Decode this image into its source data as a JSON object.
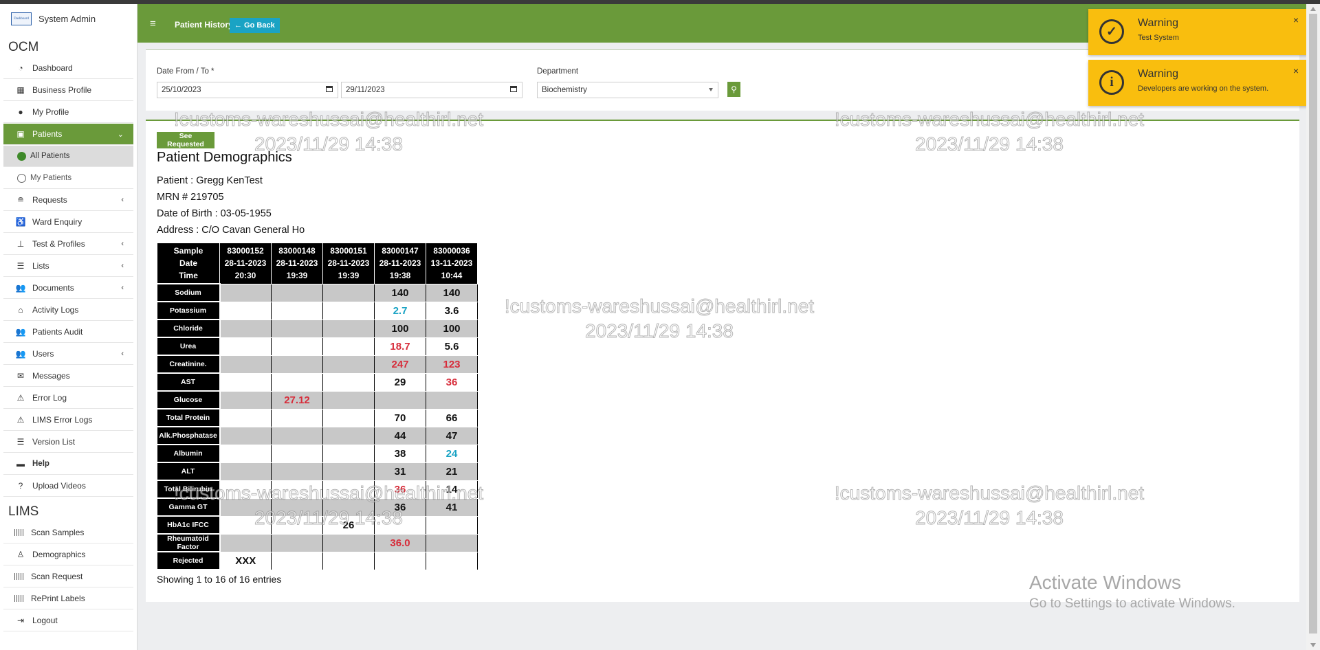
{
  "sidebar": {
    "user": "System Admin",
    "logo_text": "Dashboard",
    "sections": {
      "ocm": "OCM",
      "lims": "LIMS"
    },
    "items": [
      {
        "label": "Dashboard",
        "icon": "tachometer-icon"
      },
      {
        "label": "Business Profile",
        "icon": "building-icon"
      },
      {
        "label": "My Profile",
        "icon": "user-icon"
      },
      {
        "label": "Patients",
        "icon": "id-card-icon"
      },
      {
        "label": "All Patients"
      },
      {
        "label": "My Patients"
      },
      {
        "label": "Requests",
        "icon": "database-icon"
      },
      {
        "label": "Ward Enquiry",
        "icon": "wheelchair-icon"
      },
      {
        "label": "Test & Profiles",
        "icon": "flask-icon"
      },
      {
        "label": "Lists",
        "icon": "list-icon"
      },
      {
        "label": "Documents",
        "icon": "users-icon"
      },
      {
        "label": "Activity Logs",
        "icon": "bank-icon"
      },
      {
        "label": "Patients Audit",
        "icon": "users-icon"
      },
      {
        "label": "Users",
        "icon": "users-icon"
      },
      {
        "label": "Messages",
        "icon": "envelope-icon"
      },
      {
        "label": "Error Log",
        "icon": "warning-icon"
      },
      {
        "label": "LIMS Error Logs",
        "icon": "warning-icon"
      },
      {
        "label": "Version List",
        "icon": "list-icon"
      },
      {
        "label": "Help",
        "icon": "keyboard-icon"
      },
      {
        "label": "Upload Videos",
        "icon": "question-icon"
      }
    ],
    "lims_items": [
      {
        "label": "Scan Samples",
        "icon": "barcode-icon"
      },
      {
        "label": "Demographics",
        "icon": "user-tie-icon"
      },
      {
        "label": "Scan Request",
        "icon": "barcode-icon"
      },
      {
        "label": "RePrint Labels",
        "icon": "barcode-icon"
      },
      {
        "label": "Logout",
        "icon": "sign-out-icon"
      }
    ]
  },
  "header": {
    "menu_glyph": "≡",
    "title": "Patient History",
    "go_back": "← Go Back"
  },
  "filter": {
    "date_label": "Date From / To *",
    "date_from": "25/10/2023",
    "date_to": "29/11/2023",
    "department_label": "Department",
    "department_value": "Biochemistry",
    "search_glyph": "⚲"
  },
  "main": {
    "see_requested": "See Requested",
    "heading": "Patient Demographics",
    "patient": "Patient : Gregg KenTest",
    "mrn": "MRN # 219705",
    "dob": "Date of Birth : 03-05-1955",
    "address": "Address : C/O Cavan General Ho",
    "showing": "Showing 1 to 16 of 16 entries"
  },
  "table": {
    "header_first": [
      "Sample",
      "Date",
      "Time"
    ],
    "samples": [
      {
        "id": "83000152",
        "date": "28-11-2023",
        "time": "20:30"
      },
      {
        "id": "83000148",
        "date": "28-11-2023",
        "time": "19:39"
      },
      {
        "id": "83000151",
        "date": "28-11-2023",
        "time": "19:39"
      },
      {
        "id": "83000147",
        "date": "28-11-2023",
        "time": "19:38"
      },
      {
        "id": "83000036",
        "date": "13-11-2023",
        "time": "10:44"
      }
    ],
    "rows": [
      {
        "name": "Sodium",
        "values": [
          "",
          "",
          "",
          "140",
          "140"
        ],
        "flags": [
          "",
          "",
          "",
          "",
          ""
        ]
      },
      {
        "name": "Potassium",
        "values": [
          "",
          "",
          "",
          "2.7",
          "3.6"
        ],
        "flags": [
          "",
          "",
          "",
          "lo",
          ""
        ]
      },
      {
        "name": "Chloride",
        "values": [
          "",
          "",
          "",
          "100",
          "100"
        ],
        "flags": [
          "",
          "",
          "",
          "",
          ""
        ]
      },
      {
        "name": "Urea",
        "values": [
          "",
          "",
          "",
          "18.7",
          "5.6"
        ],
        "flags": [
          "",
          "",
          "",
          "hi",
          ""
        ]
      },
      {
        "name": "Creatinine.",
        "values": [
          "",
          "",
          "",
          "247",
          "123"
        ],
        "flags": [
          "",
          "",
          "",
          "hi",
          "hi"
        ]
      },
      {
        "name": "AST",
        "values": [
          "",
          "",
          "",
          "29",
          "36"
        ],
        "flags": [
          "",
          "",
          "",
          "",
          "hi"
        ]
      },
      {
        "name": "Glucose",
        "values": [
          "",
          "27.12",
          "",
          "",
          ""
        ],
        "flags": [
          "",
          "hi",
          "",
          "",
          ""
        ]
      },
      {
        "name": "Total Protein",
        "values": [
          "",
          "",
          "",
          "70",
          "66"
        ],
        "flags": [
          "",
          "",
          "",
          "",
          ""
        ]
      },
      {
        "name": "Alk.Phosphatase",
        "values": [
          "",
          "",
          "",
          "44",
          "47"
        ],
        "flags": [
          "",
          "",
          "",
          "",
          ""
        ]
      },
      {
        "name": "Albumin",
        "values": [
          "",
          "",
          "",
          "38",
          "24"
        ],
        "flags": [
          "",
          "",
          "",
          "",
          "lo"
        ]
      },
      {
        "name": "ALT",
        "values": [
          "",
          "",
          "",
          "31",
          "21"
        ],
        "flags": [
          "",
          "",
          "",
          "",
          ""
        ]
      },
      {
        "name": "Total Bilirubin",
        "values": [
          "",
          "",
          "",
          "36",
          "14"
        ],
        "flags": [
          "",
          "",
          "",
          "hi",
          ""
        ]
      },
      {
        "name": "Gamma GT",
        "values": [
          "",
          "",
          "",
          "36",
          "41"
        ],
        "flags": [
          "",
          "",
          "",
          "",
          ""
        ]
      },
      {
        "name": "HbA1c IFCC",
        "values": [
          "",
          "",
          "26",
          "",
          ""
        ],
        "flags": [
          "",
          "",
          "",
          "",
          ""
        ]
      },
      {
        "name": "Rheumatoid Factor",
        "values": [
          "",
          "",
          "",
          "36.0",
          ""
        ],
        "flags": [
          "",
          "",
          "",
          "hi",
          ""
        ]
      },
      {
        "name": "Rejected",
        "values": [
          "XXX",
          "",
          "",
          "",
          ""
        ],
        "flags": [
          "",
          "",
          "",
          "",
          ""
        ]
      }
    ]
  },
  "toasts": [
    {
      "title": "Warning",
      "message": "Test System",
      "icon": "check-circle-icon",
      "glyph": "✓",
      "close": "×"
    },
    {
      "title": "Warning",
      "message": "Developers are working on the system.",
      "icon": "info-circle-icon",
      "glyph": "i",
      "close": "×"
    }
  ],
  "watermark": {
    "line1": "!customs-wareshussai@healthirl.net",
    "line2": "2023/11/29 14:38"
  },
  "activate_windows": {
    "title": "Activate Windows",
    "subtitle": "Go to Settings to activate Windows."
  },
  "colors": {
    "brand_green": "#6a9a3a",
    "accent_blue": "#1aa3c4",
    "warning_yellow": "#f9be0e",
    "flag_high": "#d72c3a",
    "flag_low": "#1aa3c4"
  }
}
